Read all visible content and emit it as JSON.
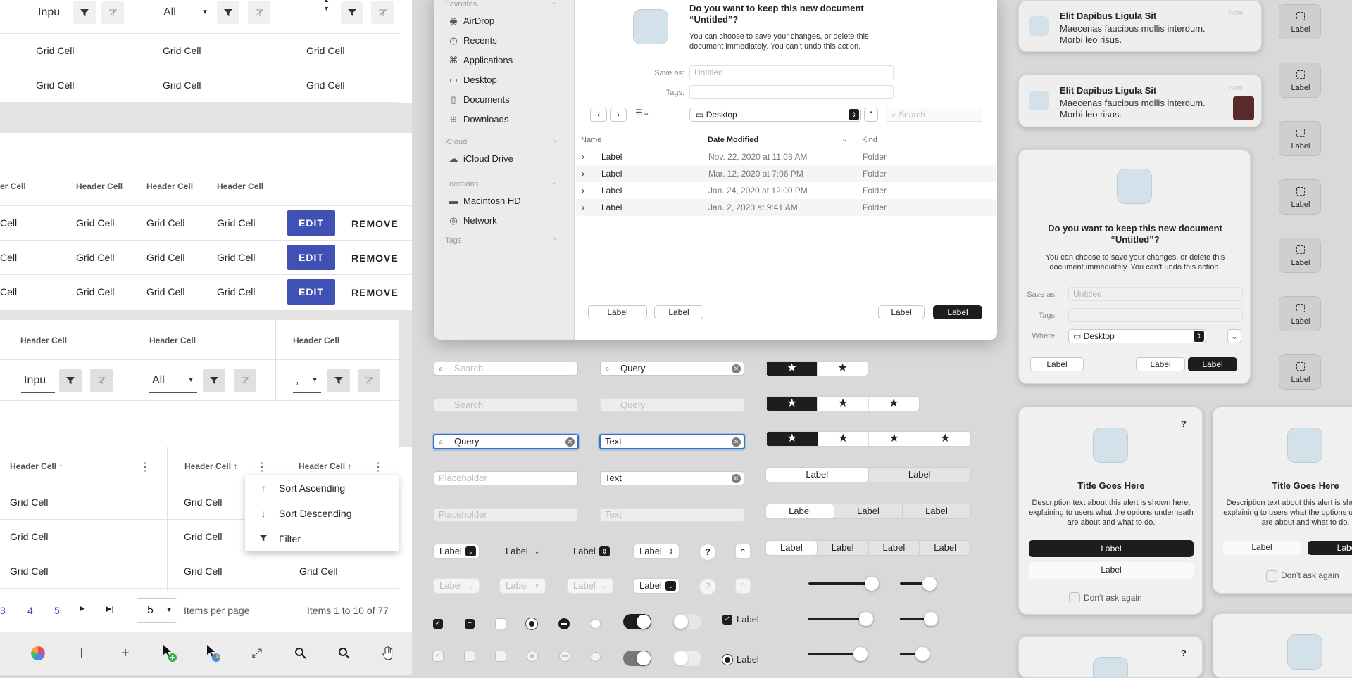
{
  "left_panel": {
    "top_table": {
      "filter_inputs": [
        "Inpu",
        "All",
        ""
      ],
      "rows": [
        [
          "Grid Cell",
          "Grid Cell",
          "Grid Cell"
        ],
        [
          "Grid Cell",
          "Grid Cell",
          "Grid Cell"
        ]
      ]
    },
    "action_table": {
      "headers": [
        "er Cell",
        "Header Cell",
        "Header Cell",
        "Header Cell"
      ],
      "rows": [
        [
          "Cell",
          "Grid Cell",
          "Grid Cell",
          "Grid Cell"
        ],
        [
          "Cell",
          "Grid Cell",
          "Grid Cell",
          "Grid Cell"
        ],
        [
          "Cell",
          "Grid Cell",
          "Grid Cell",
          "Grid Cell"
        ]
      ],
      "edit_label": "EDIT",
      "remove_label": "REMOVE"
    },
    "filter_table": {
      "headers": [
        "Header Cell",
        "Header Cell",
        "Header Cell"
      ],
      "inputs": [
        "Inpu",
        "All",
        ","
      ]
    },
    "sort_table": {
      "headers": [
        "Header Cell",
        "Header Cell",
        "Header Cell"
      ],
      "rows": [
        [
          "Grid Cell",
          "Grid Cell",
          ""
        ],
        [
          "Grid Cell",
          "Grid Cell",
          ""
        ],
        [
          "Grid Cell",
          "Grid Cell",
          "Grid Cell"
        ]
      ],
      "menu": [
        "Sort Ascending",
        "Sort Descending",
        "Filter"
      ]
    },
    "pagination": {
      "pages": [
        "3",
        "4",
        "5"
      ],
      "per_page": "5",
      "per_page_label": "Items per page",
      "range": "Items 1 to 10 of 77"
    },
    "toolbar_icons": [
      "color-wheel-icon",
      "text-cursor-icon",
      "crosshair-icon",
      "copy-cursor-icon",
      "color-cursor-icon",
      "resize-icon",
      "zoom-in-icon",
      "zoom-out-icon",
      "hand-cursor-icon"
    ]
  },
  "save_dialog": {
    "title": "Do you want to keep this new document “Untitled”?",
    "message": "You can choose to save your changes, or delete this document immediately. You can’t undo this action.",
    "save_as_label": "Save as:",
    "save_as_placeholder": "Untitled",
    "tags_label": "Tags:",
    "location": "Desktop",
    "search_placeholder": "Search",
    "sidebar": {
      "favorites": "Favorites",
      "items": [
        "AirDrop",
        "Recents",
        "Applications",
        "Desktop",
        "Documents",
        "Downloads"
      ],
      "icloud": "iCloud",
      "icloud_items": [
        "iCloud Drive"
      ],
      "locations": "Locations",
      "location_items": [
        "Macintosh HD",
        "Network"
      ],
      "tags": "Tags"
    },
    "columns": [
      "Name",
      "Date Modified",
      "Kind"
    ],
    "files": [
      {
        "name": "Label",
        "date": "Nov. 22, 2020 at 11:03 AM",
        "kind": "Folder"
      },
      {
        "name": "Label",
        "date": "Mar. 12, 2020 at 7:06 PM",
        "kind": "Folder"
      },
      {
        "name": "Label",
        "date": "Jan. 24, 2020 at 12:00 PM",
        "kind": "Folder"
      },
      {
        "name": "Label",
        "date": "Jan. 2, 2020 at 9:41 AM",
        "kind": "Folder"
      }
    ],
    "buttons": [
      "Label",
      "Label",
      "Label",
      "Label"
    ]
  },
  "controls": {
    "search_left": [
      "Search",
      "Search",
      "Query",
      "Placeholder",
      "Placeholder"
    ],
    "search_right": [
      "Query",
      "Query",
      "Text",
      "Text",
      "Text"
    ],
    "popups": [
      "Label",
      "Label",
      "Label",
      "Label"
    ],
    "popups_disabled": [
      "Label",
      "Label",
      "Label",
      "Label"
    ],
    "help": "?",
    "segments": {
      "two": [
        "Label",
        "Label"
      ],
      "three": [
        "Label",
        "Label",
        "Label"
      ],
      "four": [
        "Label",
        "Label",
        "Label",
        "Label"
      ]
    },
    "checkbox_label": "Label",
    "radio_label": "Label",
    "star": "★"
  },
  "notifications": [
    {
      "title": "Elit Dapibus Ligula Sit",
      "body": "Maecenas faucibus mollis interdum. Morbi leo risus.",
      "time": "now"
    },
    {
      "title": "Elit Dapibus Ligula Sit",
      "body": "Maecenas faucibus mollis interdum. Morbi leo risus.",
      "time": "now"
    }
  ],
  "alert_save": {
    "title": "Do you want to keep this new document “Untitled”?",
    "message": "You can choose to save your changes, or delete this document immediately. You can’t undo this action.",
    "save_as_label": "Save as:",
    "save_as_placeholder": "Untitled",
    "tags_label": "Tags:",
    "where_label": "Where:",
    "location": "Desktop",
    "buttons": [
      "Label",
      "Label",
      "Label"
    ]
  },
  "alerts": [
    {
      "title": "Title Goes Here",
      "message": "Description text about this alert is shown here, explaining to users what the options underneath are about and what to do.",
      "buttons": [
        "Label",
        "Label"
      ],
      "checkbox": "Don’t ask again",
      "help": "?"
    },
    {
      "title": "Title Goes Here",
      "message": "Description text about this alert is shown here, explaining to users what the options underneath are about and what to do.",
      "buttons": [
        "Label",
        "Labe"
      ],
      "checkbox": "Don’t ask again"
    }
  ],
  "label_buttons": [
    "Label",
    "Label",
    "Label",
    "Label",
    "Label",
    "Label",
    "Label"
  ]
}
